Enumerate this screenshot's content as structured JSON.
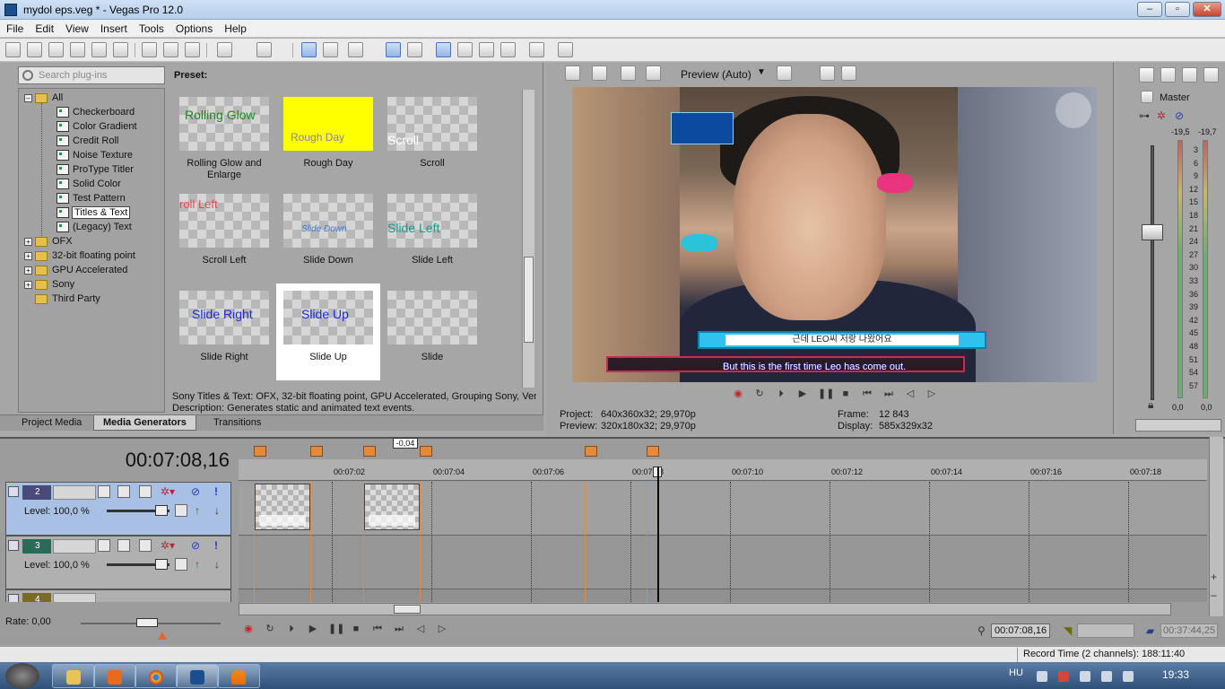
{
  "window": {
    "title": "mydol eps.veg * - Vegas Pro 12.0",
    "min": "–",
    "max": "▫",
    "close": "✕"
  },
  "menu": [
    "File",
    "Edit",
    "View",
    "Insert",
    "Tools",
    "Options",
    "Help"
  ],
  "plugins": {
    "search_placeholder": "Search plug-ins",
    "tree": [
      {
        "label": "All",
        "level": 0,
        "type": "folder",
        "expanded": true
      },
      {
        "label": "Checkerboard",
        "level": 1,
        "type": "plugin"
      },
      {
        "label": "Color Gradient",
        "level": 1,
        "type": "plugin"
      },
      {
        "label": "Credit Roll",
        "level": 1,
        "type": "plugin"
      },
      {
        "label": "Noise Texture",
        "level": 1,
        "type": "plugin"
      },
      {
        "label": "ProType Titler",
        "level": 1,
        "type": "plugin"
      },
      {
        "label": "Solid Color",
        "level": 1,
        "type": "plugin"
      },
      {
        "label": "Test Pattern",
        "level": 1,
        "type": "plugin"
      },
      {
        "label": "Titles & Text",
        "level": 1,
        "type": "plugin",
        "selected": true
      },
      {
        "label": "(Legacy) Text",
        "level": 1,
        "type": "plugin"
      },
      {
        "label": "OFX",
        "level": 0,
        "type": "folder"
      },
      {
        "label": "32-bit floating point",
        "level": 0,
        "type": "folder"
      },
      {
        "label": "GPU Accelerated",
        "level": 0,
        "type": "folder"
      },
      {
        "label": "Sony",
        "level": 0,
        "type": "folder"
      },
      {
        "label": "Third Party",
        "level": 0,
        "type": "folder"
      }
    ],
    "preset_label": "Preset:",
    "presets": [
      {
        "thumb_text": "Rolling Glow",
        "caption": "Rolling Glow and Enlarge",
        "color": "#1a8a1a",
        "bg": ""
      },
      {
        "thumb_text": "Rough Day",
        "caption": "Rough Day",
        "color": "#888888",
        "bg": "#ffff00"
      },
      {
        "thumb_text": "Scroll",
        "caption": "Scroll",
        "color": "#ffffff",
        "bg": ""
      },
      {
        "thumb_text": "roll Left",
        "caption": "Scroll Left",
        "color": "#e84a4a",
        "bg": ""
      },
      {
        "thumb_text": "Slide Down",
        "caption": "Slide Down",
        "color": "#3a7ad0",
        "bg": ""
      },
      {
        "thumb_text": "Slide Left",
        "caption": "Slide Left",
        "color": "#1a9a8a",
        "bg": ""
      },
      {
        "thumb_text": "Slide Right",
        "caption": "Slide Right",
        "color": "#1a2ad8",
        "bg": ""
      },
      {
        "thumb_text": "Slide Up",
        "caption": "Slide Up",
        "color": "#1a2ad8",
        "bg": "",
        "selected": true
      },
      {
        "thumb_text": "",
        "caption": "Slide",
        "color": "#000000",
        "bg": ""
      }
    ],
    "desc_line1": "Sony Titles & Text: OFX, 32-bit floating point, GPU Accelerated, Grouping Sony, Vers",
    "desc_line2": "Description: Generates static and animated text events.",
    "tabs": [
      "Project Media",
      "Media Generators",
      "Transitions"
    ]
  },
  "preview": {
    "mode_label": "Preview (Auto)",
    "video_subtitle": "근데 LEO씨 저랑 나왔어요",
    "video_caption": "But this is the first time Leo has come out.",
    "project_label": "Project:",
    "project_value": "640x360x32; 29,970p",
    "preview_label": "Preview:",
    "preview_value": "320x180x32; 29,970p",
    "frame_label": "Frame:",
    "frame_value": "12 843",
    "display_label": "Display:",
    "display_value": "585x329x32"
  },
  "mixer": {
    "master_label": "Master",
    "peak_left": "-19,5",
    "peak_right": "-19,7",
    "scale": [
      "3",
      "6",
      "9",
      "12",
      "15",
      "18",
      "21",
      "24",
      "27",
      "30",
      "33",
      "36",
      "39",
      "42",
      "45",
      "48",
      "51",
      "54",
      "57"
    ],
    "bottom_left": "0,0",
    "bottom_right": "0,0"
  },
  "timeline": {
    "current_time": "00:07:08,16",
    "selection_length": "-0,04",
    "ruler": [
      "00:07:02",
      "00:07:04",
      "00:07:06",
      "00:07:08",
      "00:07:10",
      "00:07:12",
      "00:07:14",
      "00:07:16",
      "00:07:18"
    ],
    "tracks": [
      {
        "number": "2",
        "level": "Level: 100,0 %"
      },
      {
        "number": "3",
        "level": "Level: 100,0 %"
      },
      {
        "number": "4",
        "level": ""
      }
    ],
    "rate_label": "Rate: 0,00",
    "cursor_time": "00:07:08,16",
    "length_time": "00:37:44,25"
  },
  "status": {
    "record_time": "Record Time (2 channels): 188:11:40"
  },
  "taskbar": {
    "lang": "HU",
    "clock": "19:33"
  },
  "colors": {
    "accent_blue": "#a8c0e4",
    "marker_orange": "#e68a3a",
    "selected_title_bg": "#ffff00"
  }
}
